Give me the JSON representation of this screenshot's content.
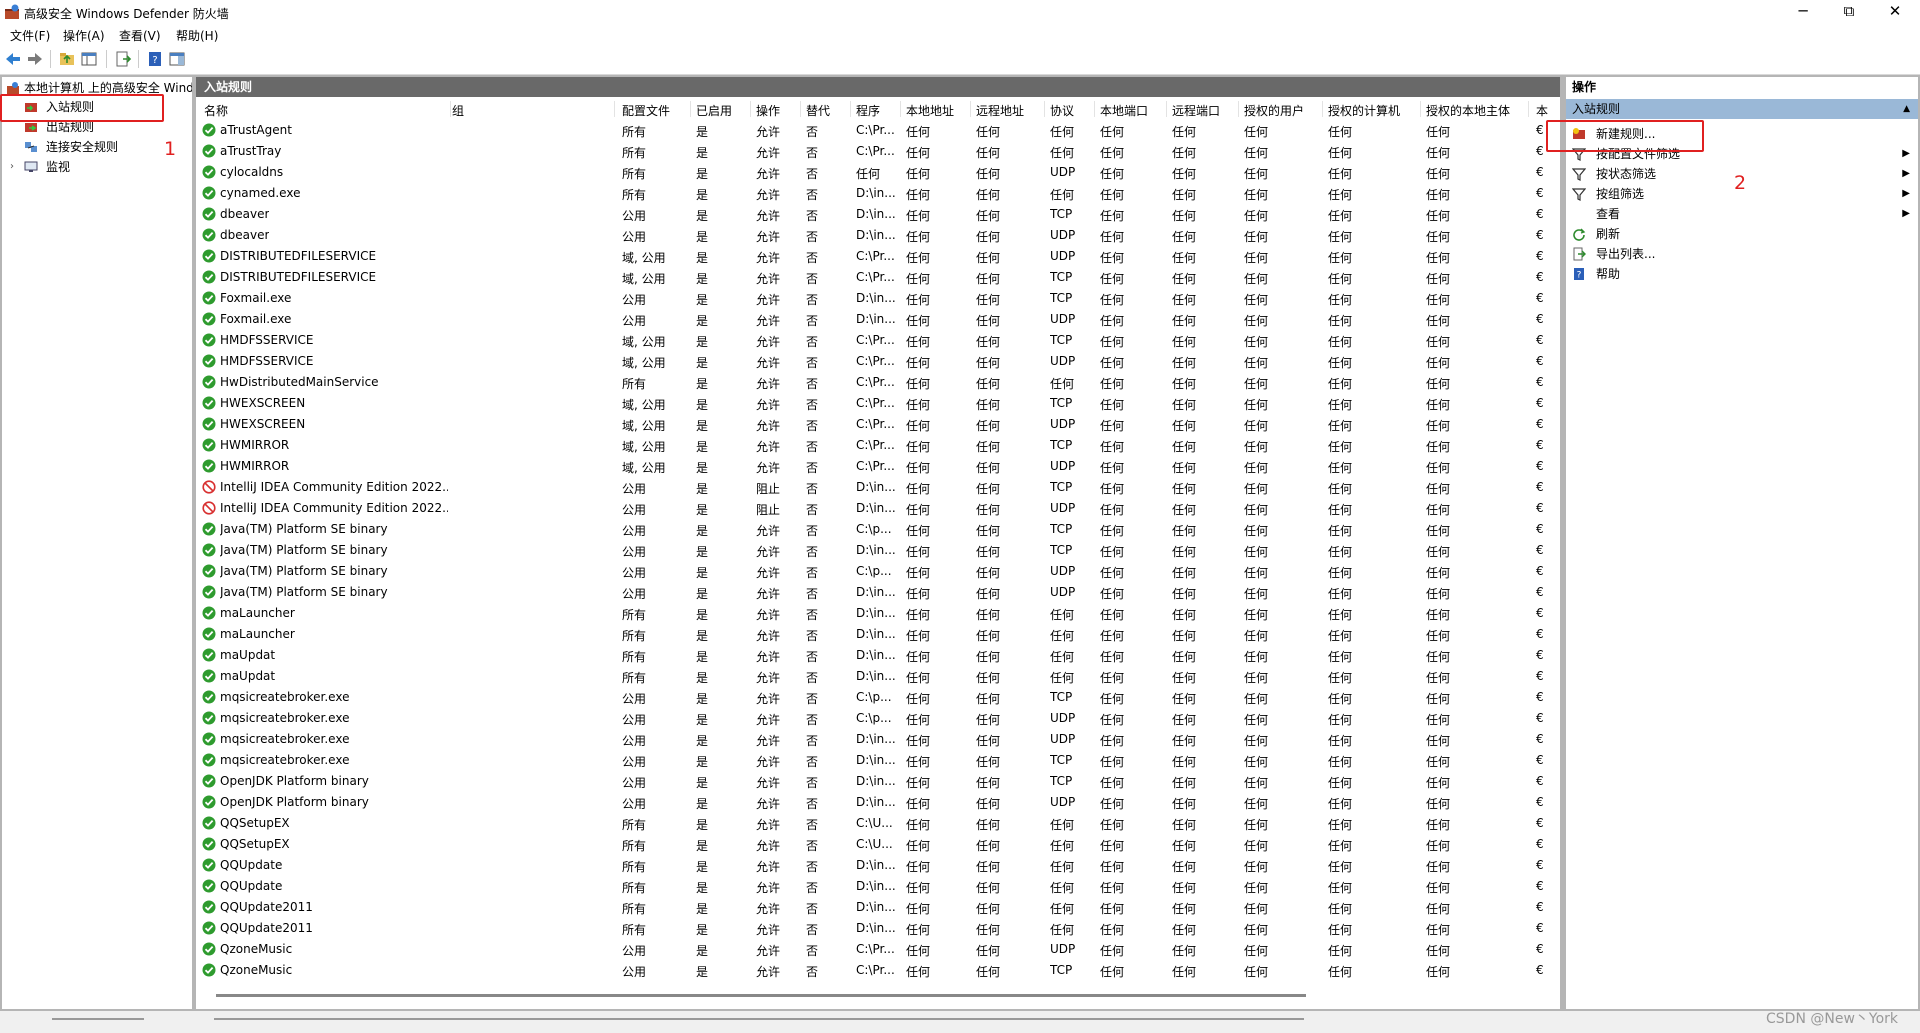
{
  "window": {
    "title": "高级安全 Windows Defender 防火墙",
    "minimize": "─",
    "maximize": "⧉",
    "close": "✕"
  },
  "menu": [
    "文件(F)",
    "操作(A)",
    "查看(V)",
    "帮助(H)"
  ],
  "tree": {
    "root": "本地计算机 上的高级安全 Windows Defender 防火墙",
    "items": [
      {
        "label": "入站规则",
        "icon": "inbound-rules-icon"
      },
      {
        "label": "出站规则",
        "icon": "outbound-rules-icon"
      },
      {
        "label": "连接安全规则",
        "icon": "connection-security-icon"
      },
      {
        "label": "监视",
        "icon": "monitor-icon"
      }
    ]
  },
  "center": {
    "header": "入站规则",
    "columns": [
      "名称",
      "组",
      "配置文件",
      "已启用",
      "操作",
      "替代",
      "程序",
      "本地地址",
      "远程地址",
      "协议",
      "本地端口",
      "远程端口",
      "授权的用户",
      "授权的计算机",
      "授权的本地主体",
      "本"
    ],
    "rows": [
      {
        "name": "aTrustAgent",
        "profile": "所有",
        "enabled": "是",
        "action": "允许",
        "override": "否",
        "program": "C:\\Pr...",
        "protocol": "任何",
        "allow": true
      },
      {
        "name": "aTrustTray",
        "profile": "所有",
        "enabled": "是",
        "action": "允许",
        "override": "否",
        "program": "C:\\Pr...",
        "protocol": "任何",
        "allow": true
      },
      {
        "name": "cylocaldns",
        "profile": "所有",
        "enabled": "是",
        "action": "允许",
        "override": "否",
        "program": "任何",
        "protocol": "UDP",
        "allow": true
      },
      {
        "name": "cynamed.exe",
        "profile": "所有",
        "enabled": "是",
        "action": "允许",
        "override": "否",
        "program": "D:\\in...",
        "protocol": "任何",
        "allow": true
      },
      {
        "name": "dbeaver",
        "profile": "公用",
        "enabled": "是",
        "action": "允许",
        "override": "否",
        "program": "D:\\in...",
        "protocol": "TCP",
        "allow": true
      },
      {
        "name": "dbeaver",
        "profile": "公用",
        "enabled": "是",
        "action": "允许",
        "override": "否",
        "program": "D:\\in...",
        "protocol": "UDP",
        "allow": true
      },
      {
        "name": "DISTRIBUTEDFILESERVICE",
        "profile": "域, 公用",
        "enabled": "是",
        "action": "允许",
        "override": "否",
        "program": "C:\\Pr...",
        "protocol": "UDP",
        "allow": true
      },
      {
        "name": "DISTRIBUTEDFILESERVICE",
        "profile": "域, 公用",
        "enabled": "是",
        "action": "允许",
        "override": "否",
        "program": "C:\\Pr...",
        "protocol": "TCP",
        "allow": true
      },
      {
        "name": "Foxmail.exe",
        "profile": "公用",
        "enabled": "是",
        "action": "允许",
        "override": "否",
        "program": "D:\\in...",
        "protocol": "TCP",
        "allow": true
      },
      {
        "name": "Foxmail.exe",
        "profile": "公用",
        "enabled": "是",
        "action": "允许",
        "override": "否",
        "program": "D:\\in...",
        "protocol": "UDP",
        "allow": true
      },
      {
        "name": "HMDFSSERVICE",
        "profile": "域, 公用",
        "enabled": "是",
        "action": "允许",
        "override": "否",
        "program": "C:\\Pr...",
        "protocol": "TCP",
        "allow": true
      },
      {
        "name": "HMDFSSERVICE",
        "profile": "域, 公用",
        "enabled": "是",
        "action": "允许",
        "override": "否",
        "program": "C:\\Pr...",
        "protocol": "UDP",
        "allow": true
      },
      {
        "name": "HwDistributedMainService",
        "profile": "所有",
        "enabled": "是",
        "action": "允许",
        "override": "否",
        "program": "C:\\Pr...",
        "protocol": "任何",
        "allow": true
      },
      {
        "name": "HWEXSCREEN",
        "profile": "域, 公用",
        "enabled": "是",
        "action": "允许",
        "override": "否",
        "program": "C:\\Pr...",
        "protocol": "TCP",
        "allow": true
      },
      {
        "name": "HWEXSCREEN",
        "profile": "域, 公用",
        "enabled": "是",
        "action": "允许",
        "override": "否",
        "program": "C:\\Pr...",
        "protocol": "UDP",
        "allow": true
      },
      {
        "name": "HWMIRROR",
        "profile": "域, 公用",
        "enabled": "是",
        "action": "允许",
        "override": "否",
        "program": "C:\\Pr...",
        "protocol": "TCP",
        "allow": true
      },
      {
        "name": "HWMIRROR",
        "profile": "域, 公用",
        "enabled": "是",
        "action": "允许",
        "override": "否",
        "program": "C:\\Pr...",
        "protocol": "UDP",
        "allow": true
      },
      {
        "name": "IntelliJ IDEA Community Edition 2022....",
        "profile": "公用",
        "enabled": "是",
        "action": "阻止",
        "override": "否",
        "program": "D:\\in...",
        "protocol": "TCP",
        "allow": false
      },
      {
        "name": "IntelliJ IDEA Community Edition 2022....",
        "profile": "公用",
        "enabled": "是",
        "action": "阻止",
        "override": "否",
        "program": "D:\\in...",
        "protocol": "UDP",
        "allow": false
      },
      {
        "name": "Java(TM) Platform SE binary",
        "profile": "公用",
        "enabled": "是",
        "action": "允许",
        "override": "否",
        "program": "C:\\p...",
        "protocol": "TCP",
        "allow": true
      },
      {
        "name": "Java(TM) Platform SE binary",
        "profile": "公用",
        "enabled": "是",
        "action": "允许",
        "override": "否",
        "program": "D:\\in...",
        "protocol": "TCP",
        "allow": true
      },
      {
        "name": "Java(TM) Platform SE binary",
        "profile": "公用",
        "enabled": "是",
        "action": "允许",
        "override": "否",
        "program": "C:\\p...",
        "protocol": "UDP",
        "allow": true
      },
      {
        "name": "Java(TM) Platform SE binary",
        "profile": "公用",
        "enabled": "是",
        "action": "允许",
        "override": "否",
        "program": "D:\\in...",
        "protocol": "UDP",
        "allow": true
      },
      {
        "name": "maLauncher",
        "profile": "所有",
        "enabled": "是",
        "action": "允许",
        "override": "否",
        "program": "D:\\in...",
        "protocol": "任何",
        "allow": true
      },
      {
        "name": "maLauncher",
        "profile": "所有",
        "enabled": "是",
        "action": "允许",
        "override": "否",
        "program": "D:\\in...",
        "protocol": "任何",
        "allow": true
      },
      {
        "name": "maUpdat",
        "profile": "所有",
        "enabled": "是",
        "action": "允许",
        "override": "否",
        "program": "D:\\in...",
        "protocol": "任何",
        "allow": true
      },
      {
        "name": "maUpdat",
        "profile": "所有",
        "enabled": "是",
        "action": "允许",
        "override": "否",
        "program": "D:\\in...",
        "protocol": "任何",
        "allow": true
      },
      {
        "name": "mqsicreatebroker.exe",
        "profile": "公用",
        "enabled": "是",
        "action": "允许",
        "override": "否",
        "program": "C:\\p...",
        "protocol": "TCP",
        "allow": true
      },
      {
        "name": "mqsicreatebroker.exe",
        "profile": "公用",
        "enabled": "是",
        "action": "允许",
        "override": "否",
        "program": "C:\\p...",
        "protocol": "UDP",
        "allow": true
      },
      {
        "name": "mqsicreatebroker.exe",
        "profile": "公用",
        "enabled": "是",
        "action": "允许",
        "override": "否",
        "program": "D:\\in...",
        "protocol": "UDP",
        "allow": true
      },
      {
        "name": "mqsicreatebroker.exe",
        "profile": "公用",
        "enabled": "是",
        "action": "允许",
        "override": "否",
        "program": "D:\\in...",
        "protocol": "TCP",
        "allow": true
      },
      {
        "name": "OpenJDK Platform binary",
        "profile": "公用",
        "enabled": "是",
        "action": "允许",
        "override": "否",
        "program": "D:\\in...",
        "protocol": "TCP",
        "allow": true
      },
      {
        "name": "OpenJDK Platform binary",
        "profile": "公用",
        "enabled": "是",
        "action": "允许",
        "override": "否",
        "program": "D:\\in...",
        "protocol": "UDP",
        "allow": true
      },
      {
        "name": "QQSetupEX",
        "profile": "所有",
        "enabled": "是",
        "action": "允许",
        "override": "否",
        "program": "C:\\U...",
        "protocol": "任何",
        "allow": true
      },
      {
        "name": "QQSetupEX",
        "profile": "所有",
        "enabled": "是",
        "action": "允许",
        "override": "否",
        "program": "C:\\U...",
        "protocol": "任何",
        "allow": true
      },
      {
        "name": "QQUpdate",
        "profile": "所有",
        "enabled": "是",
        "action": "允许",
        "override": "否",
        "program": "D:\\in...",
        "protocol": "任何",
        "allow": true
      },
      {
        "name": "QQUpdate",
        "profile": "所有",
        "enabled": "是",
        "action": "允许",
        "override": "否",
        "program": "D:\\in...",
        "protocol": "任何",
        "allow": true
      },
      {
        "name": "QQUpdate2011",
        "profile": "所有",
        "enabled": "是",
        "action": "允许",
        "override": "否",
        "program": "D:\\in...",
        "protocol": "任何",
        "allow": true
      },
      {
        "name": "QQUpdate2011",
        "profile": "所有",
        "enabled": "是",
        "action": "允许",
        "override": "否",
        "program": "D:\\in...",
        "protocol": "任何",
        "allow": true
      },
      {
        "name": "QzoneMusic",
        "profile": "公用",
        "enabled": "是",
        "action": "允许",
        "override": "否",
        "program": "C:\\Pr...",
        "protocol": "UDP",
        "allow": true
      },
      {
        "name": "QzoneMusic",
        "profile": "公用",
        "enabled": "是",
        "action": "允许",
        "override": "否",
        "program": "C:\\Pr...",
        "protocol": "TCP",
        "allow": true
      }
    ],
    "any_value": "任何",
    "last_col_value": "€"
  },
  "actions": {
    "header": "操作",
    "subheader": "入站规则",
    "items": [
      {
        "label": "新建规则...",
        "icon": "new-rule-icon",
        "has_submenu": false
      },
      {
        "label": "按配置文件筛选",
        "icon": "filter-icon",
        "has_submenu": true
      },
      {
        "label": "按状态筛选",
        "icon": "filter-icon",
        "has_submenu": true
      },
      {
        "label": "按组筛选",
        "icon": "filter-icon",
        "has_submenu": true
      },
      {
        "label": "查看",
        "icon": "",
        "has_submenu": true
      },
      {
        "label": "刷新",
        "icon": "refresh-icon",
        "has_submenu": false
      },
      {
        "label": "导出列表...",
        "icon": "export-icon",
        "has_submenu": false
      },
      {
        "label": "帮助",
        "icon": "help-icon",
        "has_submenu": false
      }
    ]
  },
  "annotations": {
    "one": "1",
    "two": "2"
  },
  "watermark": "CSDN @New丶York",
  "colors": {
    "allow": "#2e9b2e",
    "block": "#d83030",
    "header_bg": "#696969",
    "actions_sub_bg": "#9ab8d7",
    "annotation": "#e02020"
  }
}
